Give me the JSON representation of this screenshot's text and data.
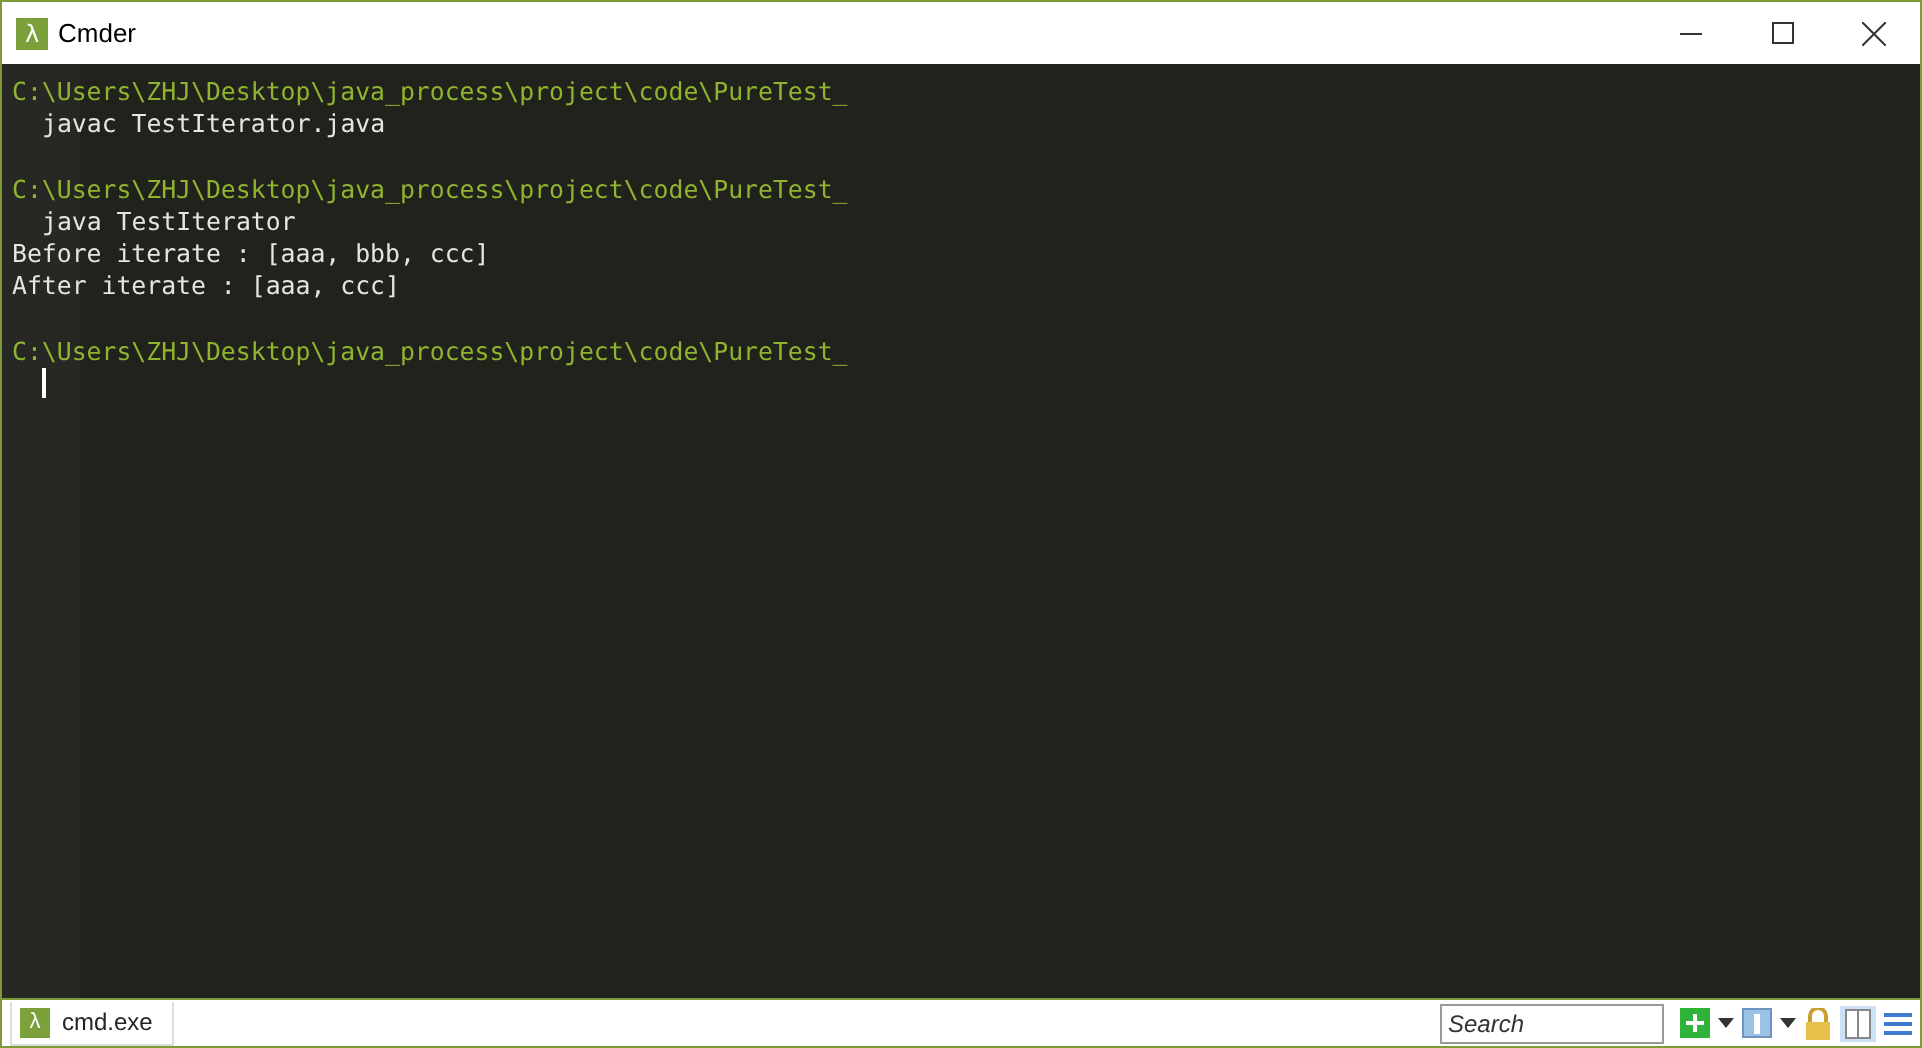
{
  "window": {
    "logo": "λ",
    "title": "Cmder"
  },
  "terminal": {
    "lines": [
      {
        "kind": "prompt",
        "text": "C:\\Users\\ZHJ\\Desktop\\java_process\\project\\code\\PureTest_"
      },
      {
        "kind": "command",
        "text": "javac TestIterator.java"
      },
      {
        "kind": "blank"
      },
      {
        "kind": "prompt",
        "text": "C:\\Users\\ZHJ\\Desktop\\java_process\\project\\code\\PureTest_"
      },
      {
        "kind": "command",
        "text": "java TestIterator"
      },
      {
        "kind": "output",
        "text": "Before iterate : [aaa, bbb, ccc]"
      },
      {
        "kind": "output",
        "text": "After iterate : [aaa, ccc]"
      },
      {
        "kind": "blank"
      },
      {
        "kind": "prompt",
        "text": "C:\\Users\\ZHJ\\Desktop\\java_process\\project\\code\\PureTest_"
      },
      {
        "kind": "cursor"
      }
    ]
  },
  "status_bar": {
    "tabs": [
      {
        "logo": "λ",
        "label": "cmd.exe",
        "selected": true
      }
    ],
    "search": {
      "placeholder": "Search"
    }
  }
}
